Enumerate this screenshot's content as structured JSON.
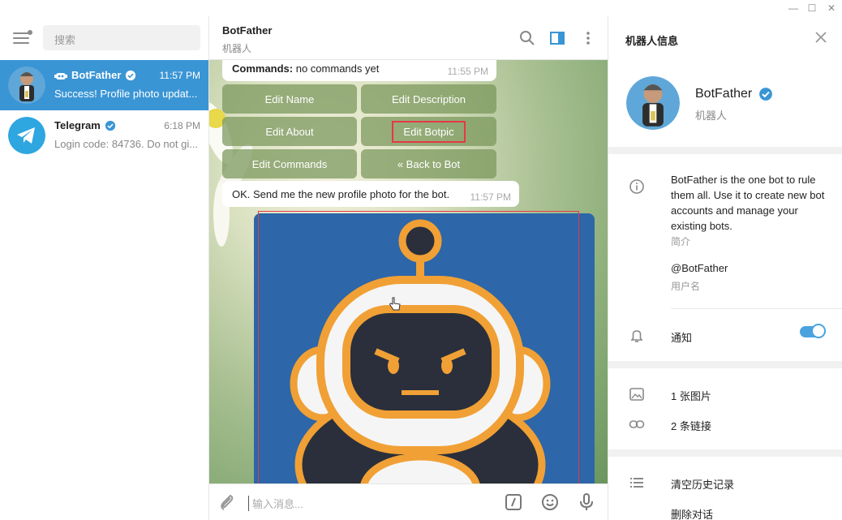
{
  "window": {
    "minimize": "—",
    "maximize": "☐",
    "close": "✕"
  },
  "sidebar": {
    "search_placeholder": "搜索",
    "chats": [
      {
        "name": "BotFather",
        "time": "11:57 PM",
        "preview": "Success! Profile photo updat...",
        "verified": true,
        "bot": true
      },
      {
        "name": "Telegram",
        "time": "6:18 PM",
        "preview": "Login code: 84736. Do not gi...",
        "verified": true
      }
    ]
  },
  "chat": {
    "title": "BotFather",
    "subtitle": "机器人",
    "messages": {
      "commands_bold": "Commands:",
      "commands_rest": " no commands yet",
      "commands_time": "11:55 PM",
      "reply": "OK. Send me the new profile photo for the bot.",
      "reply_time": "11:57 PM"
    },
    "keyboard": [
      "Edit Name",
      "Edit Description",
      "Edit About",
      "Edit Botpic",
      "Edit Commands",
      "« Back to Bot"
    ],
    "composer_placeholder": "输入消息..."
  },
  "info_panel": {
    "title": "机器人信息",
    "name": "BotFather",
    "subtitle": "机器人",
    "about": "BotFather is the one bot to rule them all. Use it to create new bot accounts and manage your existing bots.",
    "about_hint": "简介",
    "username": "@BotFather",
    "username_hint": "用户名",
    "notifications_label": "通知",
    "notifications_on": true,
    "photos": "1 张图片",
    "links": "2 条链接",
    "clear_history": "清空历史记录",
    "delete_chat": "删除对话"
  },
  "colors": {
    "accent": "#3a95d5",
    "highlight": "#e53945"
  }
}
